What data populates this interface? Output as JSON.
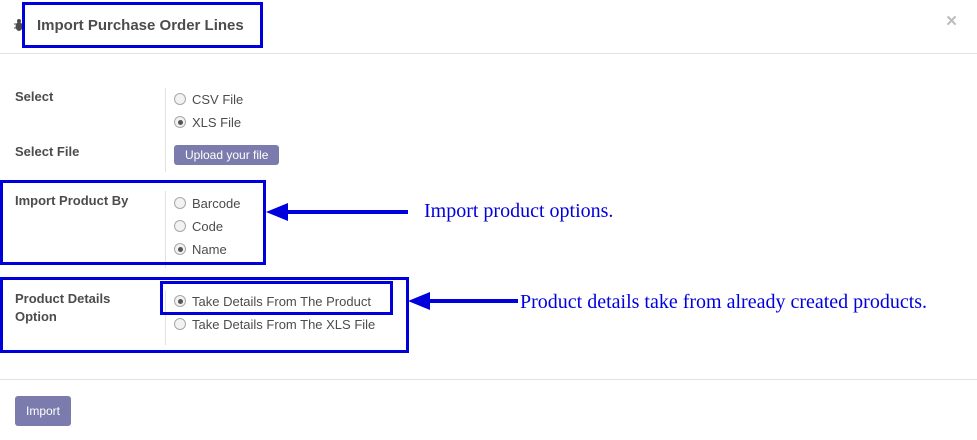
{
  "dialog": {
    "title": "Import Purchase Order Lines",
    "close_glyph": "×",
    "icons": {
      "title_icon": "bug-icon",
      "close": "close-icon"
    }
  },
  "form": {
    "select": {
      "label": "Select",
      "options": [
        {
          "label": "CSV File",
          "selected": false
        },
        {
          "label": "XLS File",
          "selected": true
        }
      ]
    },
    "select_file": {
      "label": "Select File",
      "button_label": "Upload your file"
    },
    "import_product_by": {
      "label": "Import Product By",
      "options": [
        {
          "label": "Barcode",
          "selected": false
        },
        {
          "label": "Code",
          "selected": false
        },
        {
          "label": "Name",
          "selected": true
        }
      ]
    },
    "product_details_option": {
      "label_line1": "Product Details",
      "label_line2": "Option",
      "options": [
        {
          "label": "Take Details From The Product",
          "selected": true
        },
        {
          "label": "Take Details From The XLS File",
          "selected": false
        }
      ]
    }
  },
  "footer": {
    "import_label": "Import"
  },
  "annotations": {
    "import_product": "Import product options.",
    "product_details": "Product details take from already created products.",
    "color": "#0000dd"
  },
  "colors": {
    "button": "#7c7bad",
    "highlight": "#0000dd"
  }
}
